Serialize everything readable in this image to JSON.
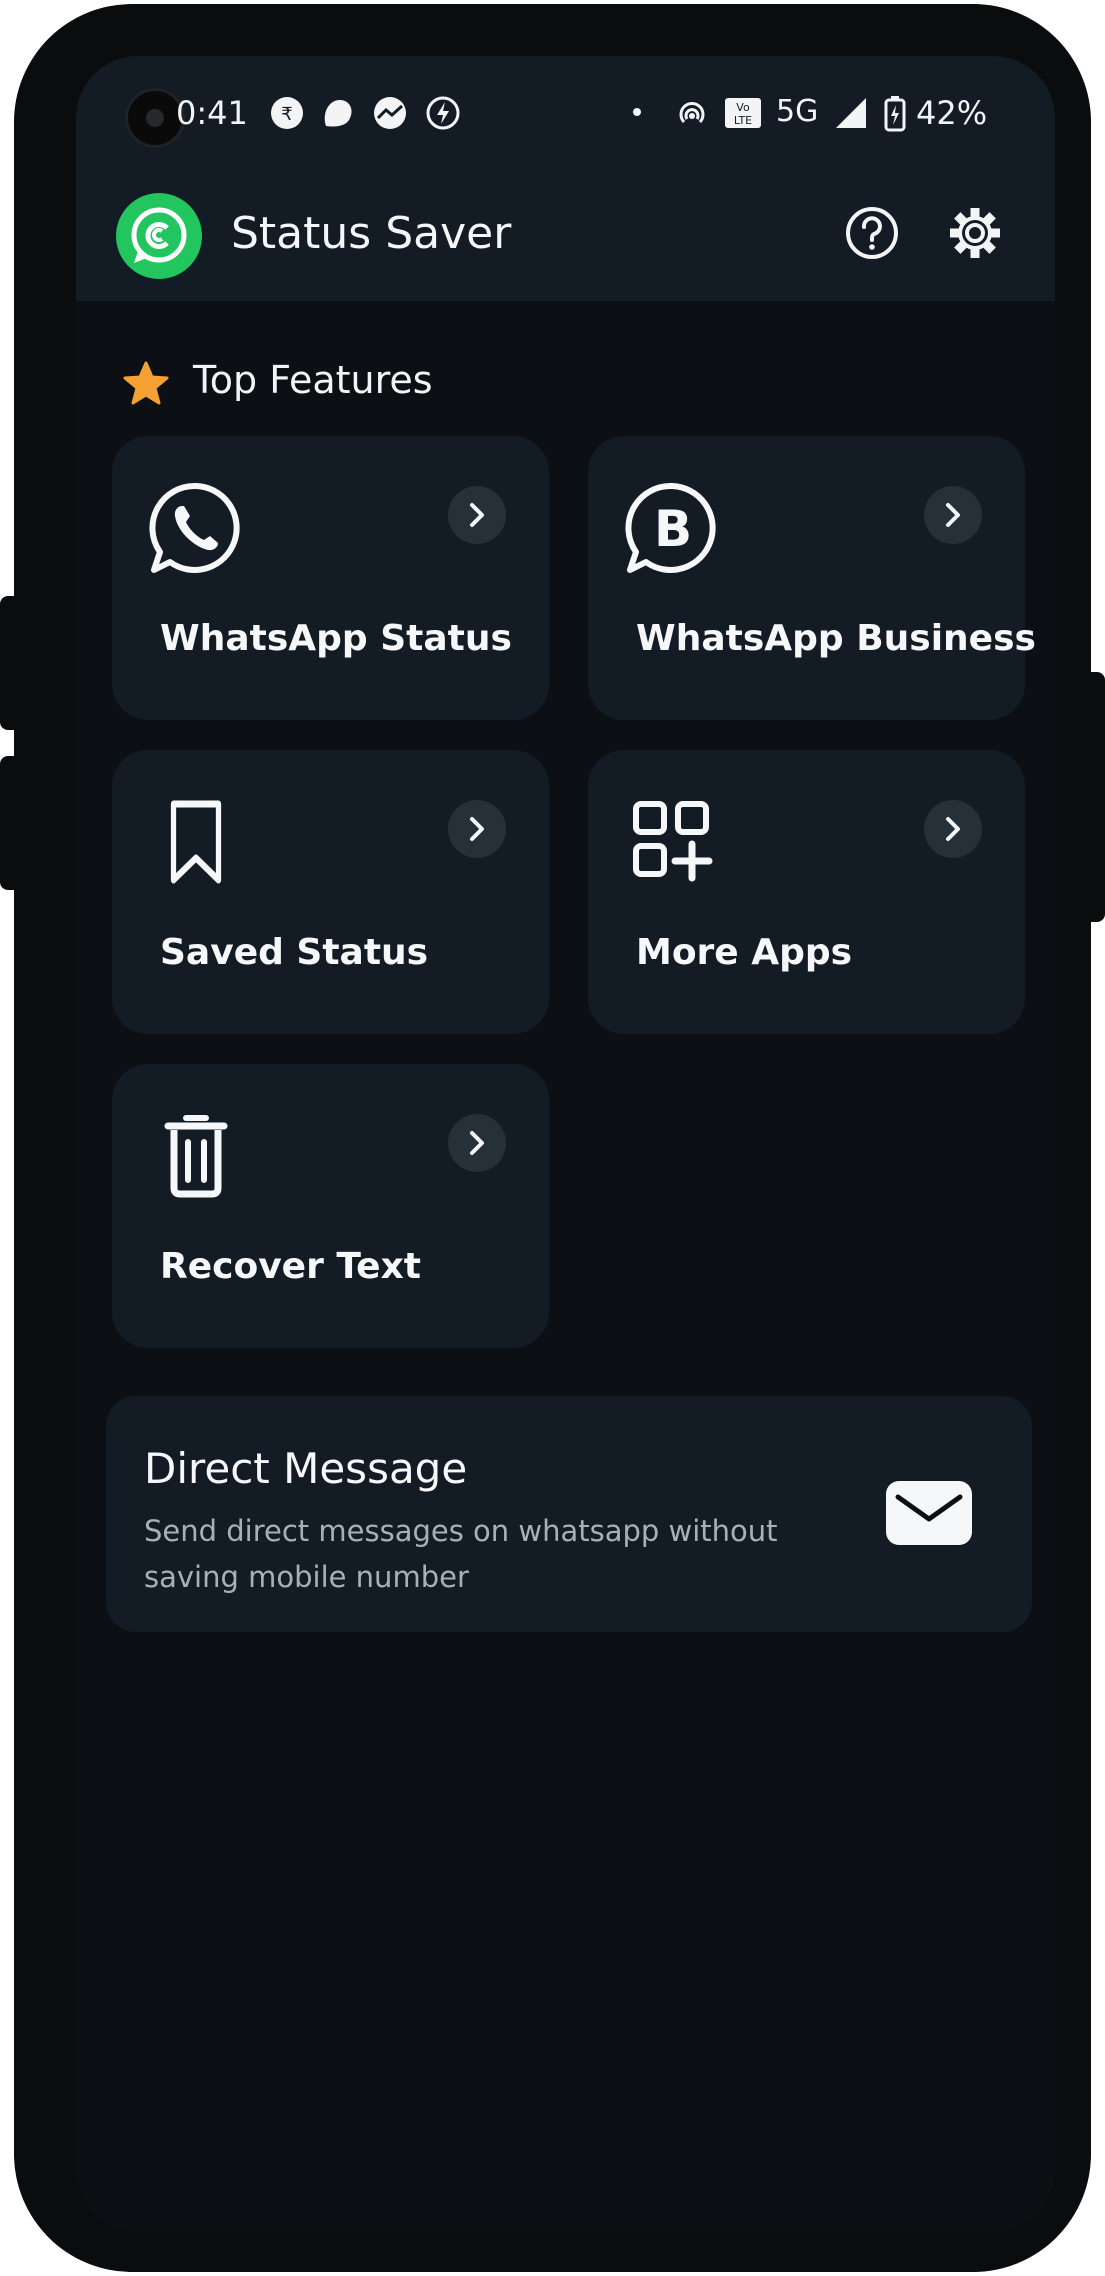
{
  "status_bar": {
    "time": "0:41",
    "network": "5G",
    "battery": "42%"
  },
  "app_bar": {
    "title": "Status Saver"
  },
  "section": {
    "title": "Top Features"
  },
  "features": [
    {
      "label": "WhatsApp Status",
      "icon": "whatsapp-icon"
    },
    {
      "label": "WhatsApp Business",
      "icon": "whatsapp-business-icon"
    },
    {
      "label": "Saved Status",
      "icon": "bookmark-icon"
    },
    {
      "label": "More Apps",
      "icon": "apps-grid-icon"
    },
    {
      "label": "Recover Text",
      "icon": "trash-icon"
    }
  ],
  "direct_message": {
    "title": "Direct Message",
    "description": "Send direct messages on whatsapp without saving mobile number",
    "icon": "mail-icon"
  },
  "colors": {
    "accent": "#22c55e",
    "star": "#f5a033",
    "background": "#0c1015",
    "card": "#131c24"
  }
}
